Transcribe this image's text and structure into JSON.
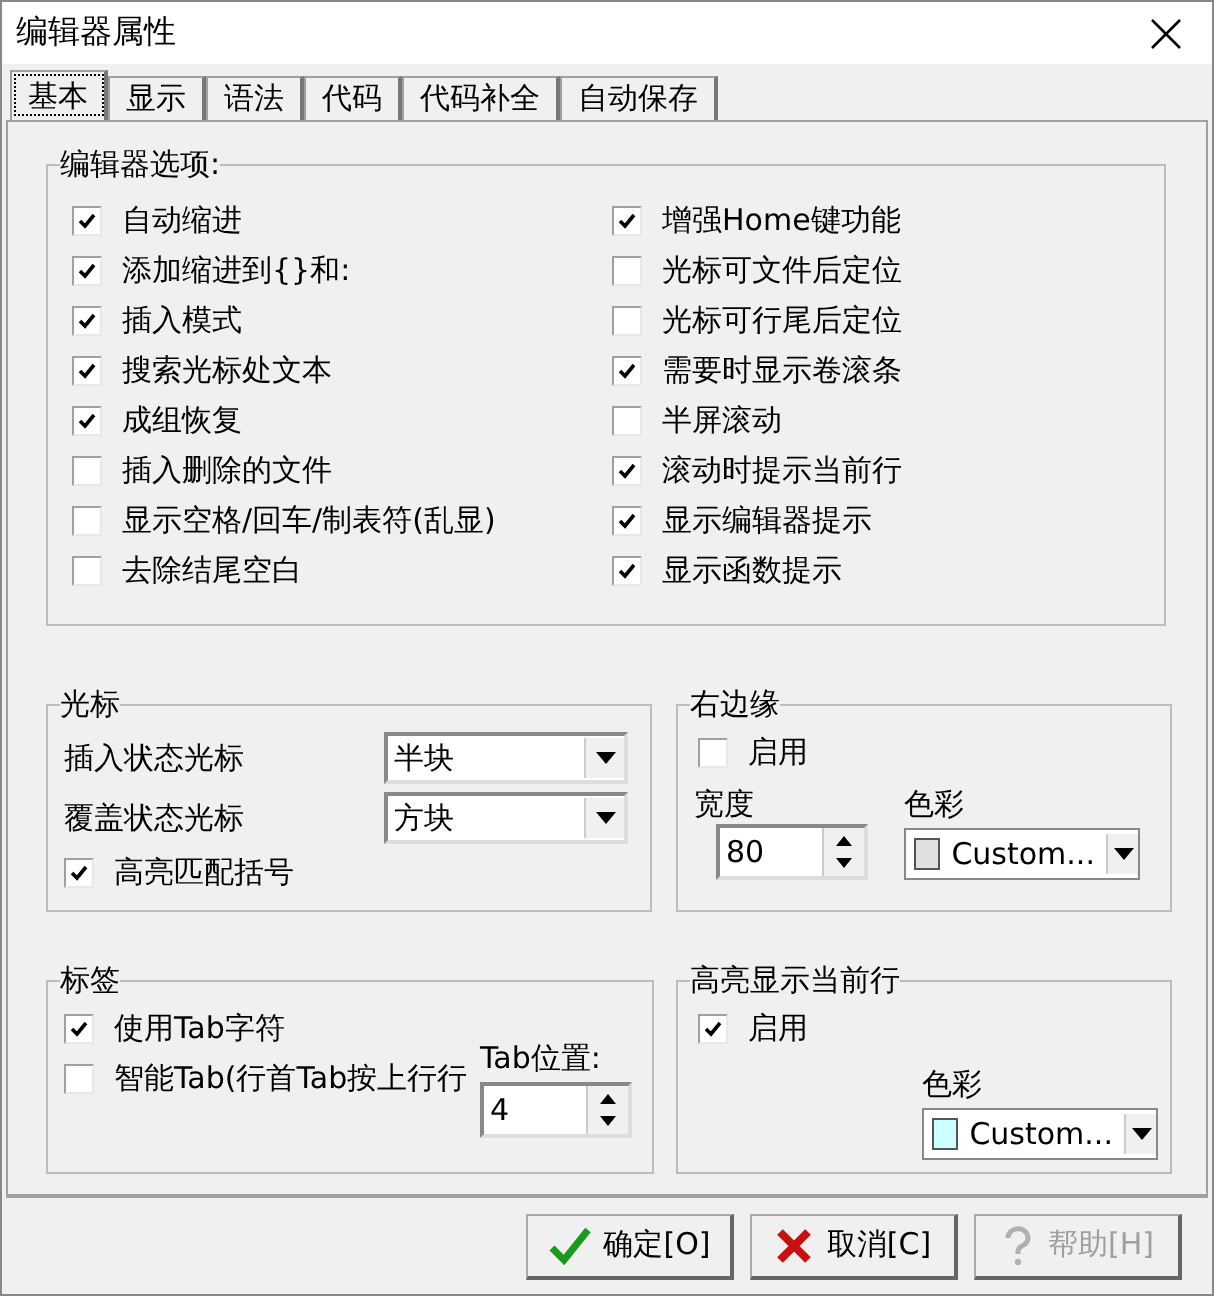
{
  "window": {
    "title": "编辑器属性"
  },
  "tabs": [
    {
      "label": "基本",
      "selected": true
    },
    {
      "label": "显示",
      "selected": false
    },
    {
      "label": "语法",
      "selected": false
    },
    {
      "label": "代码",
      "selected": false
    },
    {
      "label": "代码补全",
      "selected": false
    },
    {
      "label": "自动保存",
      "selected": false
    }
  ],
  "editor_options": {
    "title": "编辑器选项:",
    "left": [
      {
        "label": "自动缩进",
        "checked": true
      },
      {
        "label": "添加缩进到{}和:",
        "checked": true
      },
      {
        "label": "插入模式",
        "checked": true
      },
      {
        "label": "搜索光标处文本",
        "checked": true
      },
      {
        "label": "成组恢复",
        "checked": true
      },
      {
        "label": "插入删除的文件",
        "checked": false
      },
      {
        "label": "显示空格/回车/制表符(乱显)",
        "checked": false
      },
      {
        "label": "去除结尾空白",
        "checked": false
      }
    ],
    "right": [
      {
        "label": "增强Home键功能",
        "checked": true
      },
      {
        "label": "光标可文件后定位",
        "checked": false
      },
      {
        "label": "光标可行尾后定位",
        "checked": false
      },
      {
        "label": "需要时显示卷滚条",
        "checked": true
      },
      {
        "label": "半屏滚动",
        "checked": false
      },
      {
        "label": "滚动时提示当前行",
        "checked": true
      },
      {
        "label": "显示编辑器提示",
        "checked": true
      },
      {
        "label": "显示函数提示",
        "checked": true
      }
    ]
  },
  "cursor": {
    "title": "光标",
    "insert_label": "插入状态光标",
    "insert_value": "半块",
    "overwrite_label": "覆盖状态光标",
    "overwrite_value": "方块",
    "match_brackets": {
      "label": "高亮匹配括号",
      "checked": true
    }
  },
  "right_margin": {
    "title": "右边缘",
    "enable": {
      "label": "启用",
      "checked": false
    },
    "width_label": "宽度",
    "width_value": "80",
    "color_label": "色彩",
    "color_value": "Custom...",
    "color": "#e0e0e0"
  },
  "tab_settings": {
    "title": "标签",
    "use_tab": {
      "label": "使用Tab字符",
      "checked": true
    },
    "smart_tab": {
      "label": "智能Tab(行首Tab按上行行",
      "checked": false
    },
    "position_label": "Tab位置:",
    "position_value": "4"
  },
  "current_line": {
    "title": "高亮显示当前行",
    "enable": {
      "label": "启用",
      "checked": true
    },
    "color_label": "色彩",
    "color_value": "Custom...",
    "color": "#ccffff"
  },
  "buttons": [
    {
      "label": "确定[O]",
      "kind": "ok",
      "disabled": false
    },
    {
      "label": "取消[C]",
      "kind": "cancel",
      "disabled": false
    },
    {
      "label": "帮助[H]",
      "kind": "help",
      "disabled": true
    }
  ]
}
